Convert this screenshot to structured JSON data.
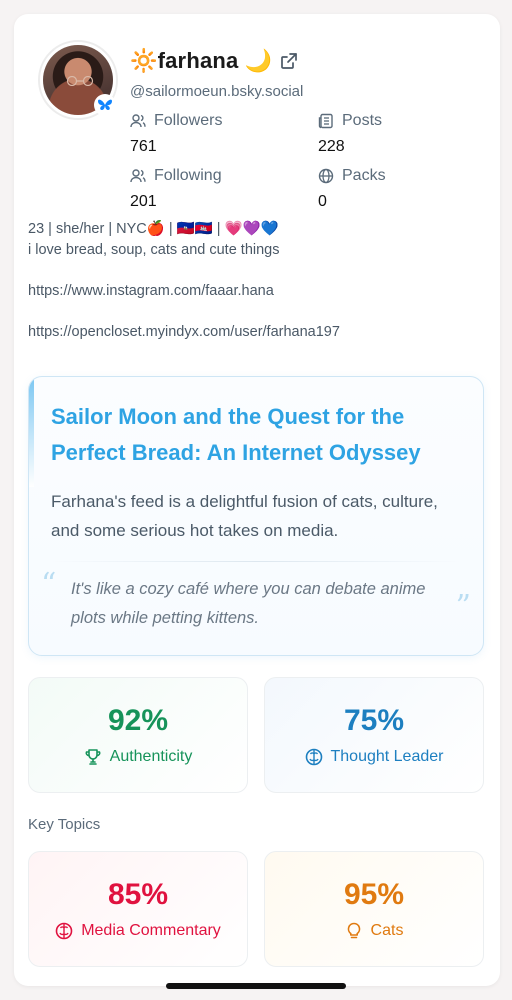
{
  "profile": {
    "display_name": "🔆farhana 🌙",
    "handle": "@sailormoeun.bsky.social",
    "avatar_badge_icon": "butterfly-icon",
    "external_link_icon": "external-link-icon"
  },
  "stats": {
    "followers_label": "Followers",
    "followers_value": "761",
    "posts_label": "Posts",
    "posts_value": "228",
    "following_label": "Following",
    "following_value": "201",
    "packs_label": "Packs",
    "packs_value": "0"
  },
  "bio": {
    "line1": "23 | she/her | NYC🍎 | 🇭🇹🇰🇭 | 💗💜💙",
    "line2": "i love bread, soup, cats and cute things",
    "link1": "https://www.instagram.com/faaar.hana",
    "link2": "https://opencloset.myindyx.com/user/farhana197"
  },
  "summary": {
    "title": "Sailor Moon and the Quest for the Perfect Bread: An Internet Odyssey",
    "description": "Farhana's feed is a delightful fusion of cats, culture, and some serious hot takes on media.",
    "quote": "It's like a cozy café where you can debate anime plots while petting kittens.",
    "quote_open": "“",
    "quote_close": "”",
    "accent_color": "#2ea3e3"
  },
  "metrics": {
    "authenticity": {
      "value": "92%",
      "label": "Authenticity",
      "icon": "trophy-icon",
      "color": "#16935a"
    },
    "thought_leader": {
      "value": "75%",
      "label": "Thought Leader",
      "icon": "brain-icon",
      "color": "#1d7fc0"
    }
  },
  "key_topics": {
    "heading": "Key Topics",
    "media_commentary": {
      "value": "85%",
      "label": "Media Commentary",
      "icon": "brain-icon",
      "color": "#e0123f"
    },
    "cats": {
      "value": "95%",
      "label": "Cats",
      "icon": "lightbulb-icon",
      "color": "#e07a10"
    }
  }
}
